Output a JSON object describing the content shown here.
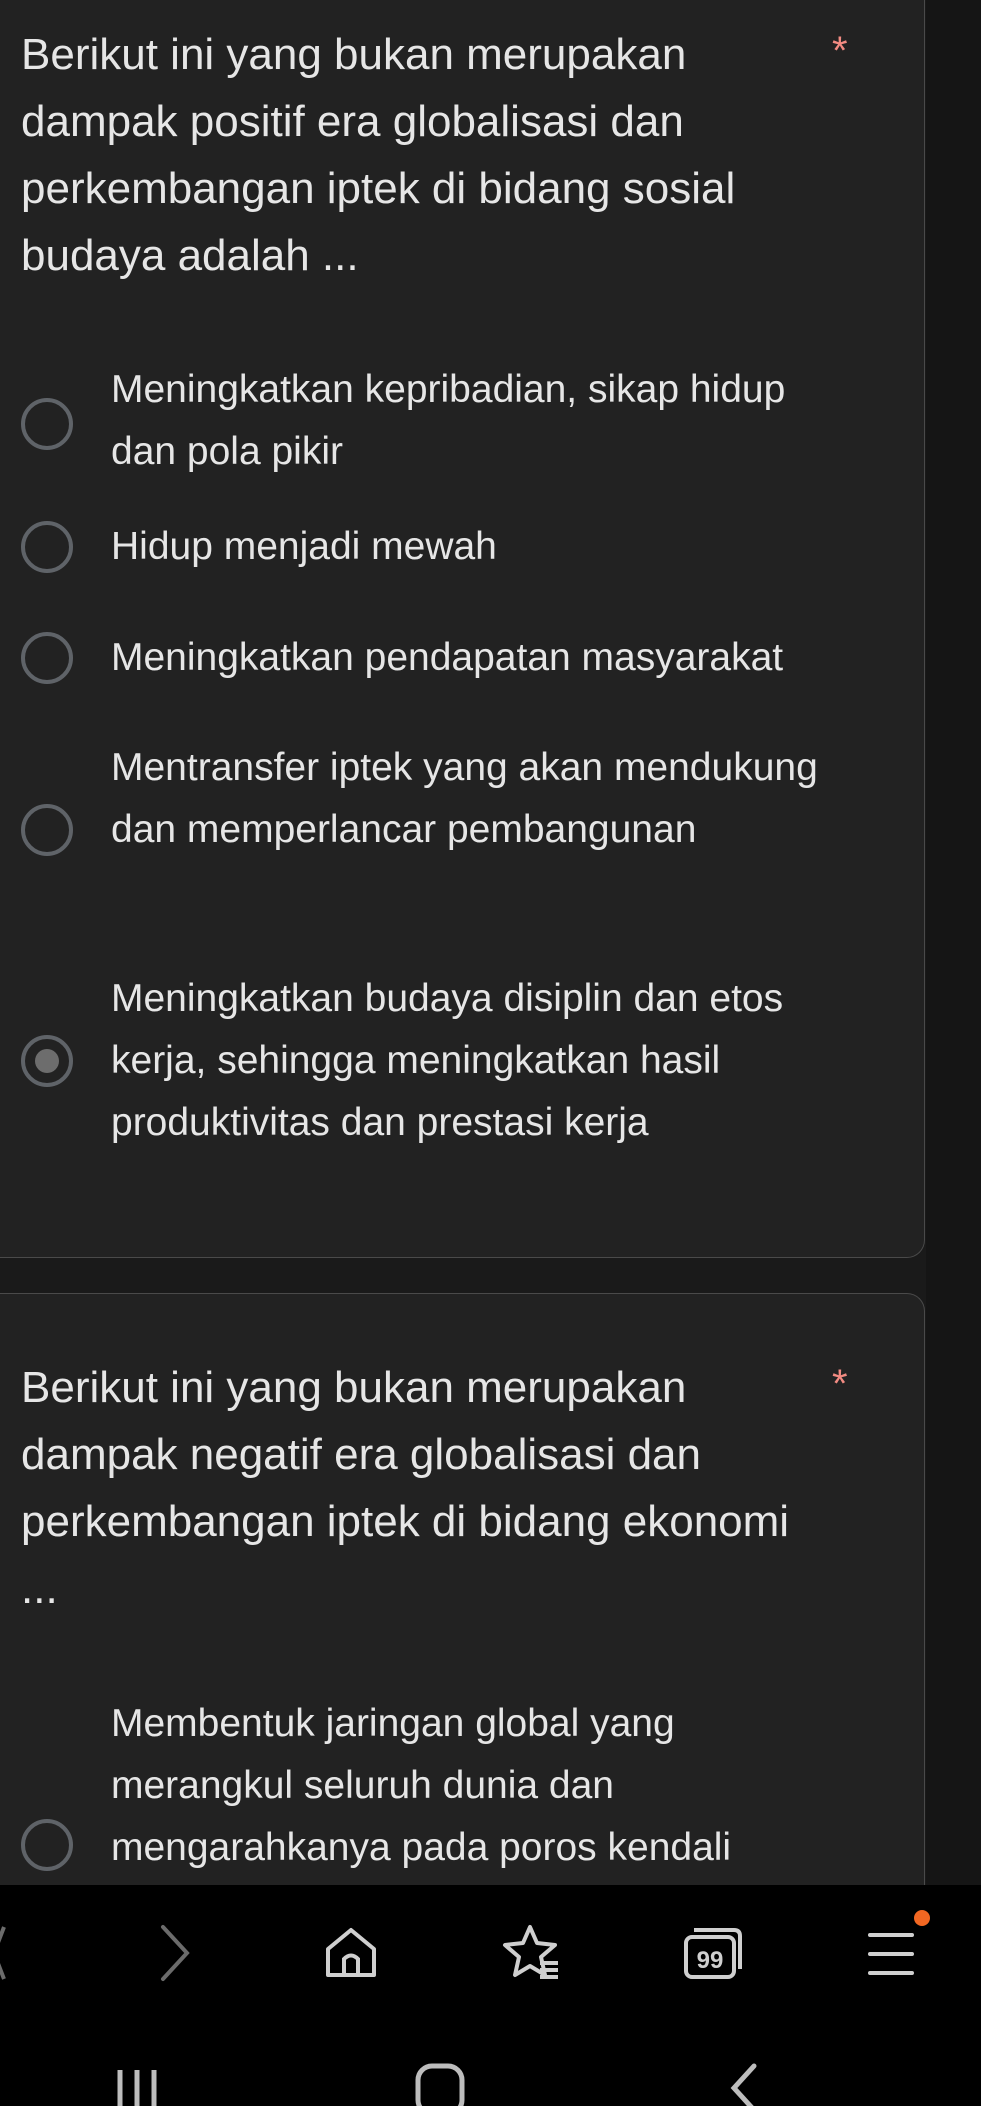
{
  "question1": {
    "title": "Berikut ini yang bukan merupakan dampak positif era globalisasi dan perkembangan iptek di bidang sosial budaya adalah ...",
    "required_mark": "*",
    "options": [
      {
        "label": "Meningkatkan kepribadian, sikap hidup dan pola pikir",
        "selected": false
      },
      {
        "label": "Hidup menjadi mewah",
        "selected": false
      },
      {
        "label": "Meningkatkan pendapatan masyarakat",
        "selected": false
      },
      {
        "label": "Mentransfer iptek yang akan mendukung dan memperlancar pembangunan",
        "selected": false
      },
      {
        "label": "Meningkatkan budaya disiplin dan etos kerja, sehingga meningkatkan hasil produktivitas dan prestasi kerja",
        "selected": true
      }
    ]
  },
  "question2": {
    "title": "Berikut ini yang bukan merupakan dampak negatif era globalisasi dan perkembangan iptek di bidang ekonomi ...",
    "required_mark": "*",
    "options": [
      {
        "label": "Membentuk jaringan global yang merangkul seluruh dunia dan mengarahkanya pada poros kendali",
        "selected": false
      }
    ]
  },
  "browser_toolbar": {
    "icons": [
      "back-arrow-icon",
      "forward-arrow-icon",
      "home-icon",
      "bookmarks-icon",
      "tabs-icon",
      "menu-icon"
    ],
    "tabs_count": "99",
    "notification_color": "#f26722"
  },
  "system_nav": {
    "icons": [
      "recents-icon",
      "home-button-icon",
      "back-icon"
    ]
  },
  "colors": {
    "card_background": "#222222",
    "page_background": "#1a1a1a",
    "required_star": "#f28b82"
  }
}
